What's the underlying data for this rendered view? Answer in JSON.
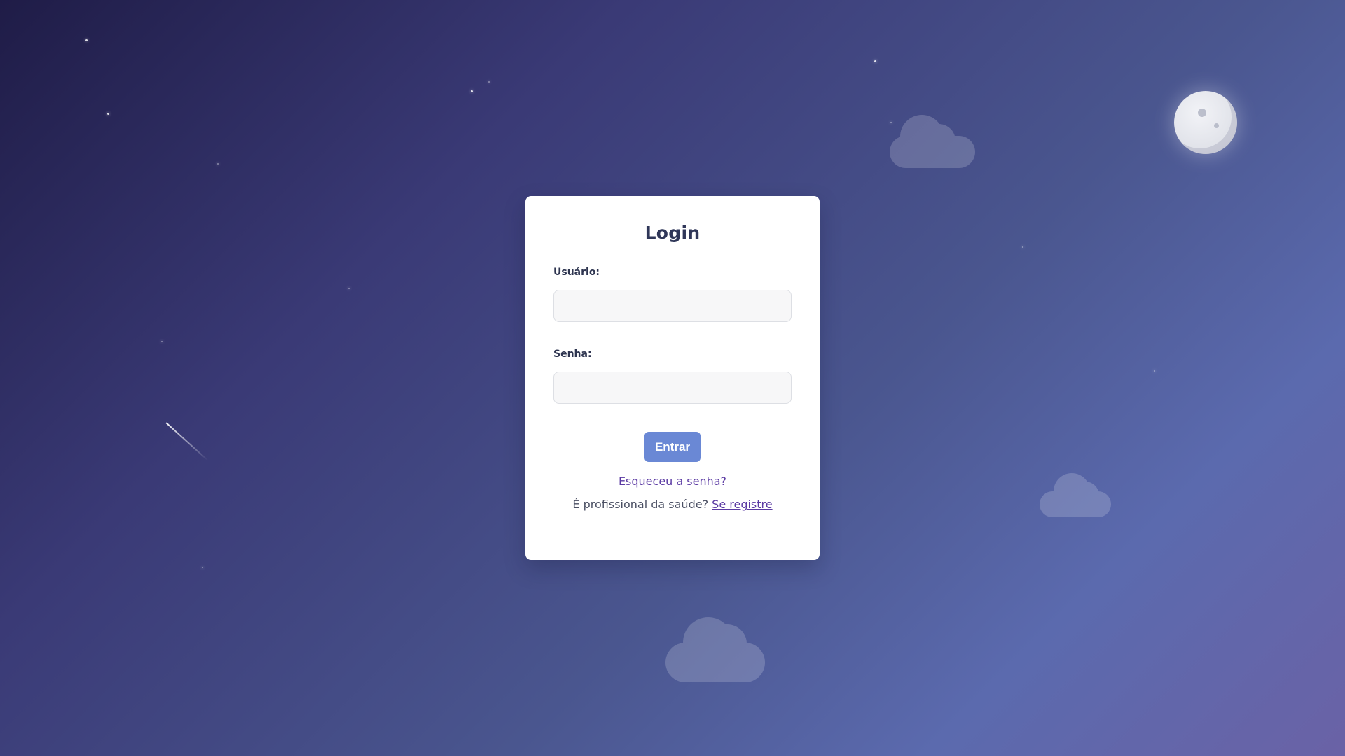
{
  "login": {
    "title": "Login",
    "username_label": "Usuário:",
    "username_value": "",
    "password_label": "Senha:",
    "password_value": "",
    "submit_label": "Entrar",
    "forgot_password_link": "Esqueceu a senha?",
    "register_prompt": "É profissional da saúde?",
    "register_link": "Se registre"
  },
  "colors": {
    "card_background": "#ffffff",
    "primary_button": "#6a88d5",
    "link": "#5b3aa3",
    "title_text": "#2f3658"
  }
}
